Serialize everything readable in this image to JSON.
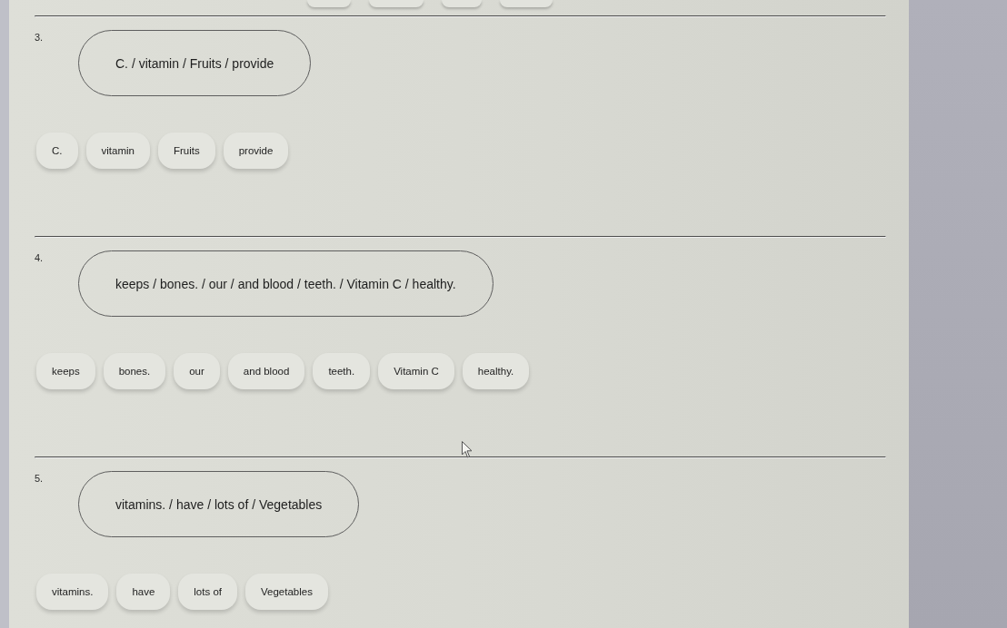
{
  "questions": [
    {
      "number": "3.",
      "sentence": "C. / vitamin / Fruits / provide",
      "words": [
        "C.",
        "vitamin",
        "Fruits",
        "provide"
      ]
    },
    {
      "number": "4.",
      "sentence": "keeps / bones. / our / and blood / teeth. / Vitamin C / healthy.",
      "words": [
        "keeps",
        "bones.",
        "our",
        "and blood",
        "teeth.",
        "Vitamin C",
        "healthy."
      ]
    },
    {
      "number": "5.",
      "sentence": "vitamins. / have / lots of / Vegetables",
      "words": [
        "vitamins.",
        "have",
        "lots of",
        "Vegetables"
      ]
    }
  ]
}
